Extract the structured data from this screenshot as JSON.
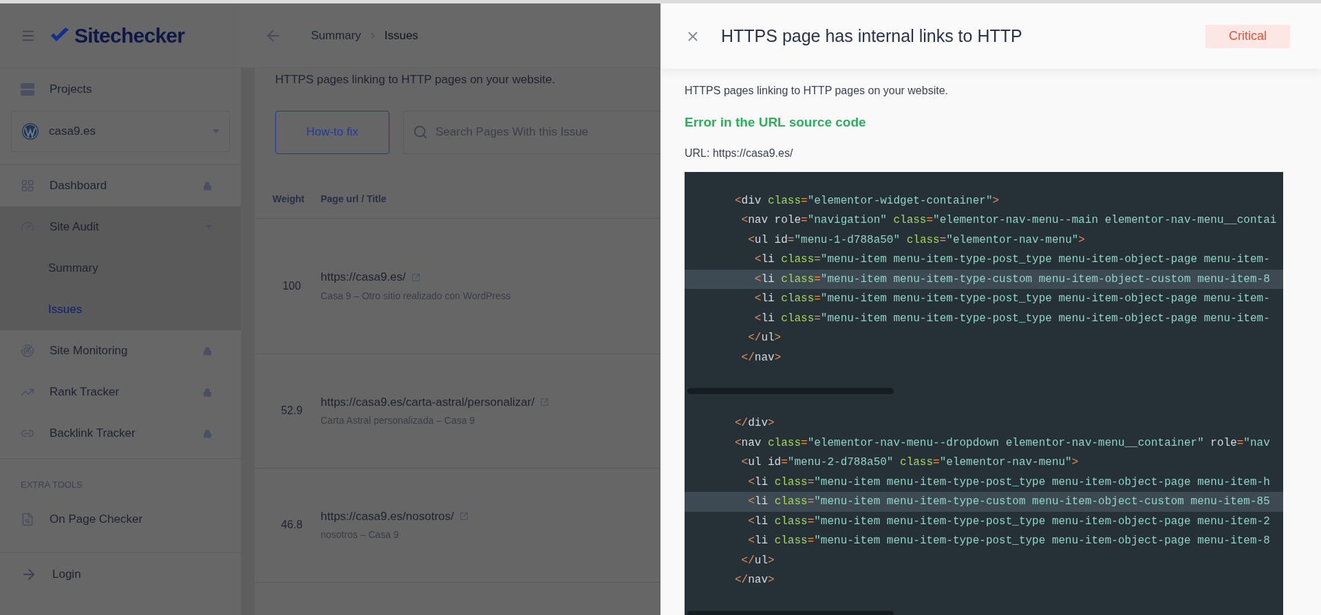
{
  "sidebar": {
    "logo": "Sitechecker",
    "projects_label": "Projects",
    "project_select": {
      "value": "casa9.es"
    },
    "items": [
      {
        "label": "Dashboard",
        "locked": true
      },
      {
        "label": "Site Audit",
        "locked": false,
        "expanded": true,
        "children": [
          {
            "label": "Summary",
            "selected": false
          },
          {
            "label": "Issues",
            "selected": true
          }
        ]
      },
      {
        "label": "Site Monitoring",
        "locked": true
      },
      {
        "label": "Rank Tracker",
        "locked": true
      },
      {
        "label": "Backlink Tracker",
        "locked": true
      }
    ],
    "extra_heading": "EXTRA TOOLS",
    "extra_items": [
      {
        "label": "On Page Checker"
      }
    ],
    "login": "Login"
  },
  "main": {
    "breadcrumb": [
      "Summary",
      "Issues"
    ],
    "description": "HTTPS pages linking to HTTP pages on your website.",
    "how_to_fix_button": "How-to fix",
    "search": {
      "placeholder": "Search Pages With this Issue"
    },
    "table": {
      "columns": [
        "Weight",
        "Page url / Title"
      ],
      "rows": [
        {
          "weight": "100",
          "url": "https://casa9.es/",
          "title": "Casa 9 – Otro sitio realizado con WordPress"
        },
        {
          "weight": "52.9",
          "url": "https://casa9.es/carta-astral/personalizar/",
          "title": "Carta Astral personalizada – Casa 9"
        },
        {
          "weight": "46.8",
          "url": "https://casa9.es/nosotros/",
          "title": "nosotros – Casa 9"
        }
      ]
    }
  },
  "drawer": {
    "title": "HTTPS page has internal links to HTTP",
    "severity": "Critical",
    "description": "HTTPS pages linking to HTTP pages on your website.",
    "section_heading": "Error in the URL source code",
    "url_line": "URL: https://casa9.es/",
    "code_blocks": [
      {
        "lines": [
          {
            "highlighted": false,
            "tokens": [
              {
                "kind": "punct",
                "text": "<"
              },
              {
                "kind": "name",
                "text": "div "
              },
              {
                "kind": "attr",
                "text": "class"
              },
              {
                "kind": "punct",
                "text": "="
              },
              {
                "kind": "string",
                "text": "\"elementor-widget-container\""
              },
              {
                "kind": "punct",
                "text": ">"
              }
            ]
          },
          {
            "highlighted": false,
            "tokens": [
              {
                "kind": "punct",
                "text": " <"
              },
              {
                "kind": "name",
                "text": "nav role"
              },
              {
                "kind": "punct",
                "text": "="
              },
              {
                "kind": "string",
                "text": "\"navigation\" "
              },
              {
                "kind": "attr",
                "text": "class"
              },
              {
                "kind": "punct",
                "text": "="
              },
              {
                "kind": "string",
                "text": "\"elementor-nav-menu--main elementor-nav-menu__contai"
              }
            ]
          },
          {
            "highlighted": false,
            "tokens": [
              {
                "kind": "punct",
                "text": "  <"
              },
              {
                "kind": "name",
                "text": "ul id"
              },
              {
                "kind": "punct",
                "text": "="
              },
              {
                "kind": "string",
                "text": "\"menu-1-d788a50\" "
              },
              {
                "kind": "attr",
                "text": "class"
              },
              {
                "kind": "punct",
                "text": "="
              },
              {
                "kind": "string",
                "text": "\"elementor-nav-menu\""
              },
              {
                "kind": "punct",
                "text": ">"
              }
            ]
          },
          {
            "highlighted": false,
            "tokens": [
              {
                "kind": "punct",
                "text": "   <"
              },
              {
                "kind": "name",
                "text": "li "
              },
              {
                "kind": "attr",
                "text": "class"
              },
              {
                "kind": "punct",
                "text": "="
              },
              {
                "kind": "string",
                "text": "\"menu-item menu-item-type-post_type menu-item-object-page menu-item-"
              }
            ]
          },
          {
            "highlighted": true,
            "tokens": [
              {
                "kind": "punct",
                "text": "   <"
              },
              {
                "kind": "name",
                "text": "li "
              },
              {
                "kind": "attr",
                "text": "class"
              },
              {
                "kind": "punct",
                "text": "="
              },
              {
                "kind": "string",
                "text": "\"menu-item menu-item-type-custom menu-item-object-custom menu-item-8"
              }
            ]
          },
          {
            "highlighted": false,
            "tokens": [
              {
                "kind": "punct",
                "text": "   <"
              },
              {
                "kind": "name",
                "text": "li "
              },
              {
                "kind": "attr",
                "text": "class"
              },
              {
                "kind": "punct",
                "text": "="
              },
              {
                "kind": "string",
                "text": "\"menu-item menu-item-type-post_type menu-item-object-page menu-item-"
              }
            ]
          },
          {
            "highlighted": false,
            "tokens": [
              {
                "kind": "punct",
                "text": "   <"
              },
              {
                "kind": "name",
                "text": "li "
              },
              {
                "kind": "attr",
                "text": "class"
              },
              {
                "kind": "punct",
                "text": "="
              },
              {
                "kind": "string",
                "text": "\"menu-item menu-item-type-post_type menu-item-object-page menu-item-"
              }
            ]
          },
          {
            "highlighted": false,
            "tokens": [
              {
                "kind": "punct",
                "text": "  </"
              },
              {
                "kind": "name",
                "text": "ul"
              },
              {
                "kind": "punct",
                "text": ">"
              }
            ]
          },
          {
            "highlighted": false,
            "tokens": [
              {
                "kind": "punct",
                "text": " </"
              },
              {
                "kind": "name",
                "text": "nav"
              },
              {
                "kind": "punct",
                "text": ">"
              }
            ]
          }
        ]
      },
      {
        "lines": [
          {
            "highlighted": false,
            "tokens": [
              {
                "kind": "punct",
                "text": "</"
              },
              {
                "kind": "name",
                "text": "div"
              },
              {
                "kind": "punct",
                "text": ">"
              }
            ]
          },
          {
            "highlighted": false,
            "tokens": [
              {
                "kind": "punct",
                "text": "<"
              },
              {
                "kind": "name",
                "text": "nav "
              },
              {
                "kind": "attr",
                "text": "class"
              },
              {
                "kind": "punct",
                "text": "="
              },
              {
                "kind": "string",
                "text": "\"elementor-nav-menu--dropdown elementor-nav-menu__container\" "
              },
              {
                "kind": "name",
                "text": "role"
              },
              {
                "kind": "punct",
                "text": "="
              },
              {
                "kind": "string",
                "text": "\"nav"
              }
            ]
          },
          {
            "highlighted": false,
            "tokens": [
              {
                "kind": "punct",
                "text": " <"
              },
              {
                "kind": "name",
                "text": "ul id"
              },
              {
                "kind": "punct",
                "text": "="
              },
              {
                "kind": "string",
                "text": "\"menu-2-d788a50\" "
              },
              {
                "kind": "attr",
                "text": "class"
              },
              {
                "kind": "punct",
                "text": "="
              },
              {
                "kind": "string",
                "text": "\"elementor-nav-menu\""
              },
              {
                "kind": "punct",
                "text": ">"
              }
            ]
          },
          {
            "highlighted": false,
            "tokens": [
              {
                "kind": "punct",
                "text": "  <"
              },
              {
                "kind": "name",
                "text": "li "
              },
              {
                "kind": "attr",
                "text": "class"
              },
              {
                "kind": "punct",
                "text": "="
              },
              {
                "kind": "string",
                "text": "\"menu-item menu-item-type-post_type menu-item-object-page menu-item-h"
              }
            ]
          },
          {
            "highlighted": true,
            "tokens": [
              {
                "kind": "punct",
                "text": "  <"
              },
              {
                "kind": "name",
                "text": "li "
              },
              {
                "kind": "attr",
                "text": "class"
              },
              {
                "kind": "punct",
                "text": "="
              },
              {
                "kind": "string",
                "text": "\"menu-item menu-item-type-custom menu-item-object-custom menu-item-85"
              }
            ]
          },
          {
            "highlighted": false,
            "tokens": [
              {
                "kind": "punct",
                "text": "  <"
              },
              {
                "kind": "name",
                "text": "li "
              },
              {
                "kind": "attr",
                "text": "class"
              },
              {
                "kind": "punct",
                "text": "="
              },
              {
                "kind": "string",
                "text": "\"menu-item menu-item-type-post_type menu-item-object-page menu-item-2"
              }
            ]
          },
          {
            "highlighted": false,
            "tokens": [
              {
                "kind": "punct",
                "text": "  <"
              },
              {
                "kind": "name",
                "text": "li "
              },
              {
                "kind": "attr",
                "text": "class"
              },
              {
                "kind": "punct",
                "text": "="
              },
              {
                "kind": "string",
                "text": "\"menu-item menu-item-type-post_type menu-item-object-page menu-item-8"
              }
            ]
          },
          {
            "highlighted": false,
            "tokens": [
              {
                "kind": "punct",
                "text": " </"
              },
              {
                "kind": "name",
                "text": "ul"
              },
              {
                "kind": "punct",
                "text": ">"
              }
            ]
          },
          {
            "highlighted": false,
            "tokens": [
              {
                "kind": "punct",
                "text": "</"
              },
              {
                "kind": "name",
                "text": "nav"
              },
              {
                "kind": "punct",
                "text": ">"
              }
            ]
          }
        ]
      }
    ]
  }
}
